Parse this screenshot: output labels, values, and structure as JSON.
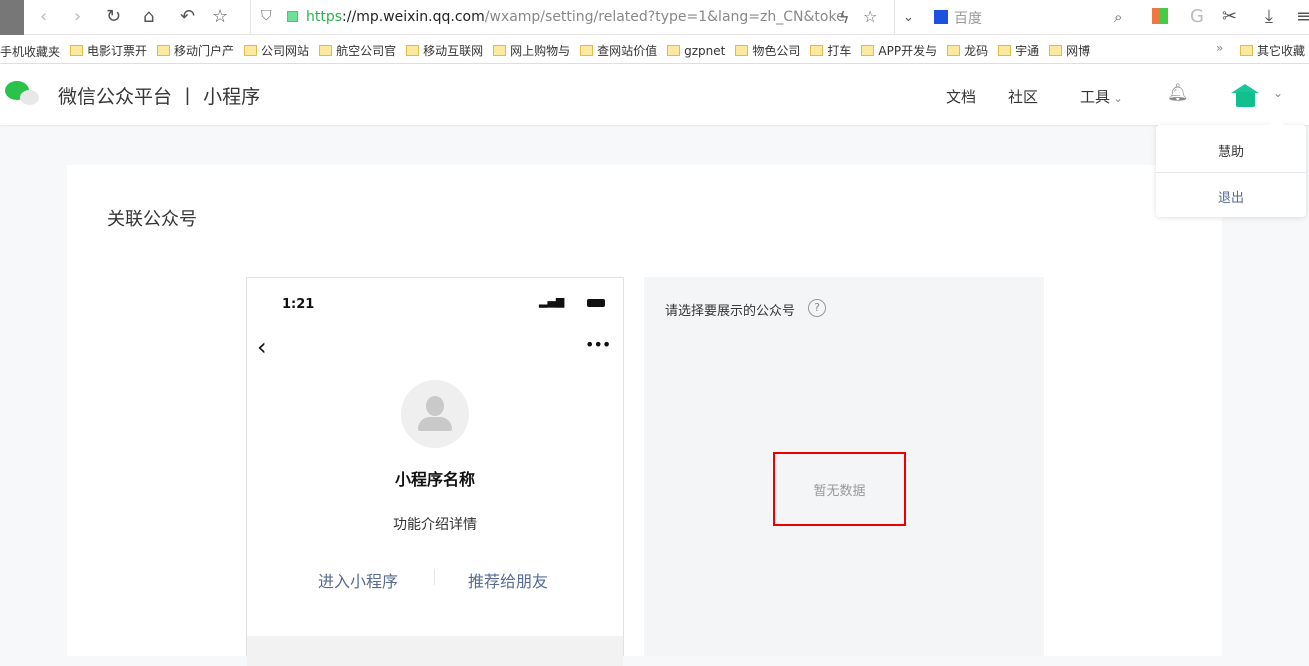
{
  "browser": {
    "url_scheme": "https",
    "url_host": "://mp.weixin.qq.com",
    "url_path": "/wxamp/setting/related?type=1&lang=zh_CN&toke",
    "search_placeholder": "百度"
  },
  "bookmarks": [
    "手机收藏夹",
    "电影订票开",
    "移动门户产",
    "公司网站",
    "航空公司官",
    "移动互联网",
    "网上购物与",
    "查网站价值",
    "gzpnet",
    "物色公司",
    "打车",
    "APP开发与",
    "龙码",
    "宇通",
    "网博"
  ],
  "bookmarks_more": "»",
  "bookmarks_other": "其它收藏",
  "header": {
    "brand": "微信公众平台 丨 小程序",
    "nav": {
      "docs": "文档",
      "community": "社区",
      "tools": "工具"
    }
  },
  "dropdown": {
    "username": "慧助",
    "logout": "退出"
  },
  "page": {
    "title": "关联公众号"
  },
  "phone": {
    "time": "1:21",
    "app_name": "小程序名称",
    "description": "功能介绍详情",
    "enter": "进入小程序",
    "recommend": "推荐给朋友"
  },
  "panel": {
    "label": "请选择要展示的公众号",
    "empty": "暂无数据"
  },
  "colors": {
    "accent": "#07c160",
    "link": "#576b95",
    "highlight": "#e00000"
  }
}
